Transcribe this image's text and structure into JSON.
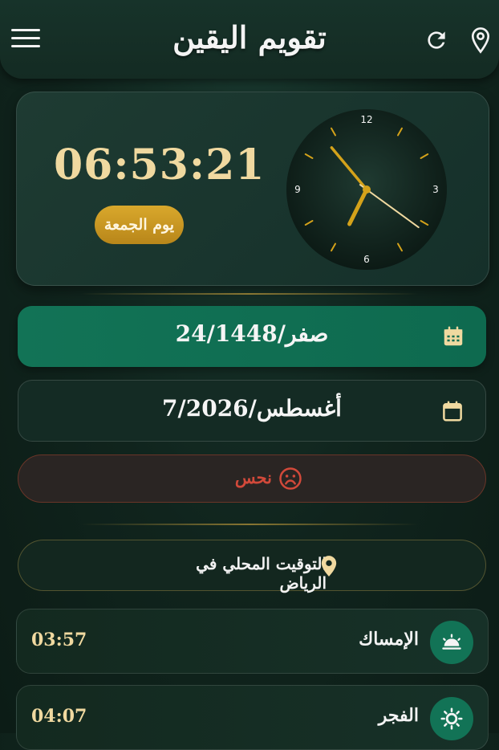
{
  "header": {
    "title": "تقويم اليقين",
    "menu_icon": "hamburger-menu-icon",
    "refresh_icon": "refresh-icon",
    "location_icon": "location-pin-icon"
  },
  "clock": {
    "digital_time": "06:53:21",
    "day_label": "يوم الجمعة",
    "numerals": {
      "twelve": "12",
      "three": "3",
      "six": "6",
      "nine": "9"
    },
    "hands": {
      "hours": 6,
      "minutes": 53,
      "seconds": 21
    }
  },
  "dates": {
    "hijri": "24/صفر/1448",
    "hijri_icon": "calendar-grid-icon",
    "gregorian": "7/أغسطس/2026",
    "gregorian_icon": "calendar-icon"
  },
  "omen": {
    "label": "نحس",
    "icon": "sad-face-icon",
    "color": "#d2493a"
  },
  "location": {
    "label": "التوقيت المحلي في الرياض",
    "icon": "location-pin-icon"
  },
  "prayers": [
    {
      "name": "الإمساك",
      "time": "03:57",
      "icon": "sunrise-icon"
    },
    {
      "name": "الفجر",
      "time": "04:07",
      "icon": "sun-icon"
    }
  ],
  "colors": {
    "accent_green": "#127356",
    "gold": "#f0d9a0",
    "badge_gold": "#d9a82c",
    "omen_red": "#d2493a"
  }
}
